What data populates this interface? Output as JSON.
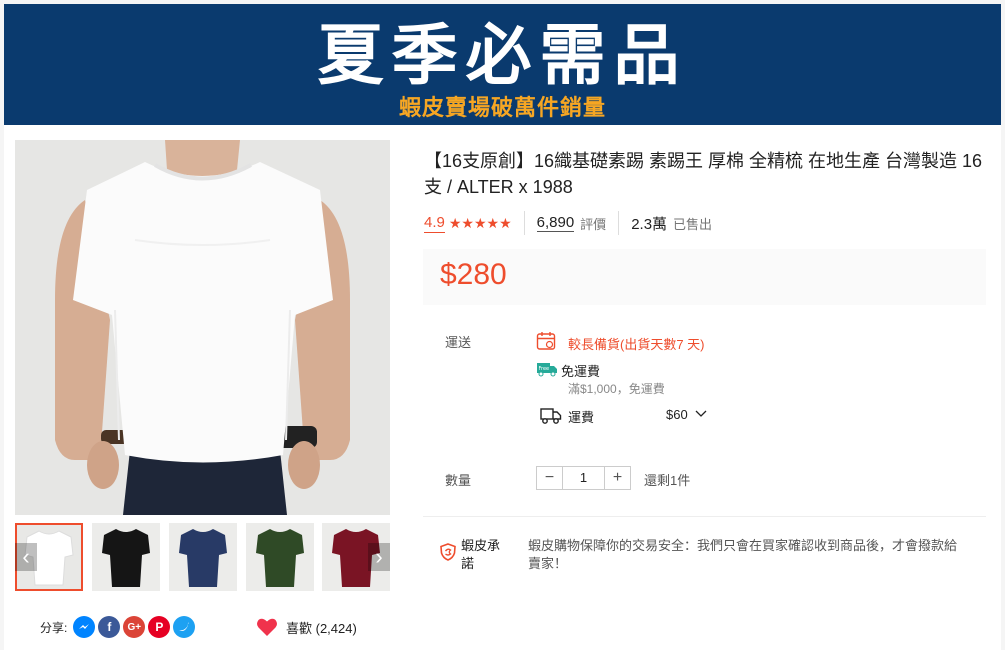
{
  "banner": {
    "title": "夏季必需品",
    "subtitle": "蝦皮賣場破萬件銷量"
  },
  "product": {
    "title": "【16支原創】16織基礎素踢 素踢王 厚棉 全精梳 在地生產 台灣製造 16支 / ALTER x 1988",
    "rating": "4.9",
    "stars": "★★★★★",
    "reviews_count": "6,890",
    "reviews_label": "評價",
    "sold_count": "2.3萬",
    "sold_label": "已售出",
    "price": "$280"
  },
  "shipping": {
    "label": "運送",
    "preorder": "較長備貨(出貨天數7 天)",
    "free_title": "免運費",
    "free_condition": "滿$1,000，免運費",
    "fee_label": "運費",
    "fee_value": "$60"
  },
  "quantity": {
    "label": "數量",
    "value": "1",
    "minus": "−",
    "plus": "+",
    "stock": "還剩1件"
  },
  "guarantee": {
    "label": "蝦皮承諾",
    "text": "蝦皮購物保障你的交易安全：我們只會在買家確認收到商品後，才會撥款給賣家！"
  },
  "share": {
    "label": "分享:",
    "icons": [
      "messenger-icon",
      "facebook-icon",
      "google-plus-icon",
      "pinterest-icon",
      "twitter-icon"
    ]
  },
  "like": {
    "label": "喜歡 (2,424)"
  },
  "gallery": {
    "thumb_colors": [
      "#ffffff",
      "#151515",
      "#283a66",
      "#2f4a26",
      "#7a1424"
    ]
  },
  "colors": {
    "accent": "#ee4d2d",
    "banner_bg": "#0a3a6e",
    "banner_sub": "#f6a623"
  }
}
